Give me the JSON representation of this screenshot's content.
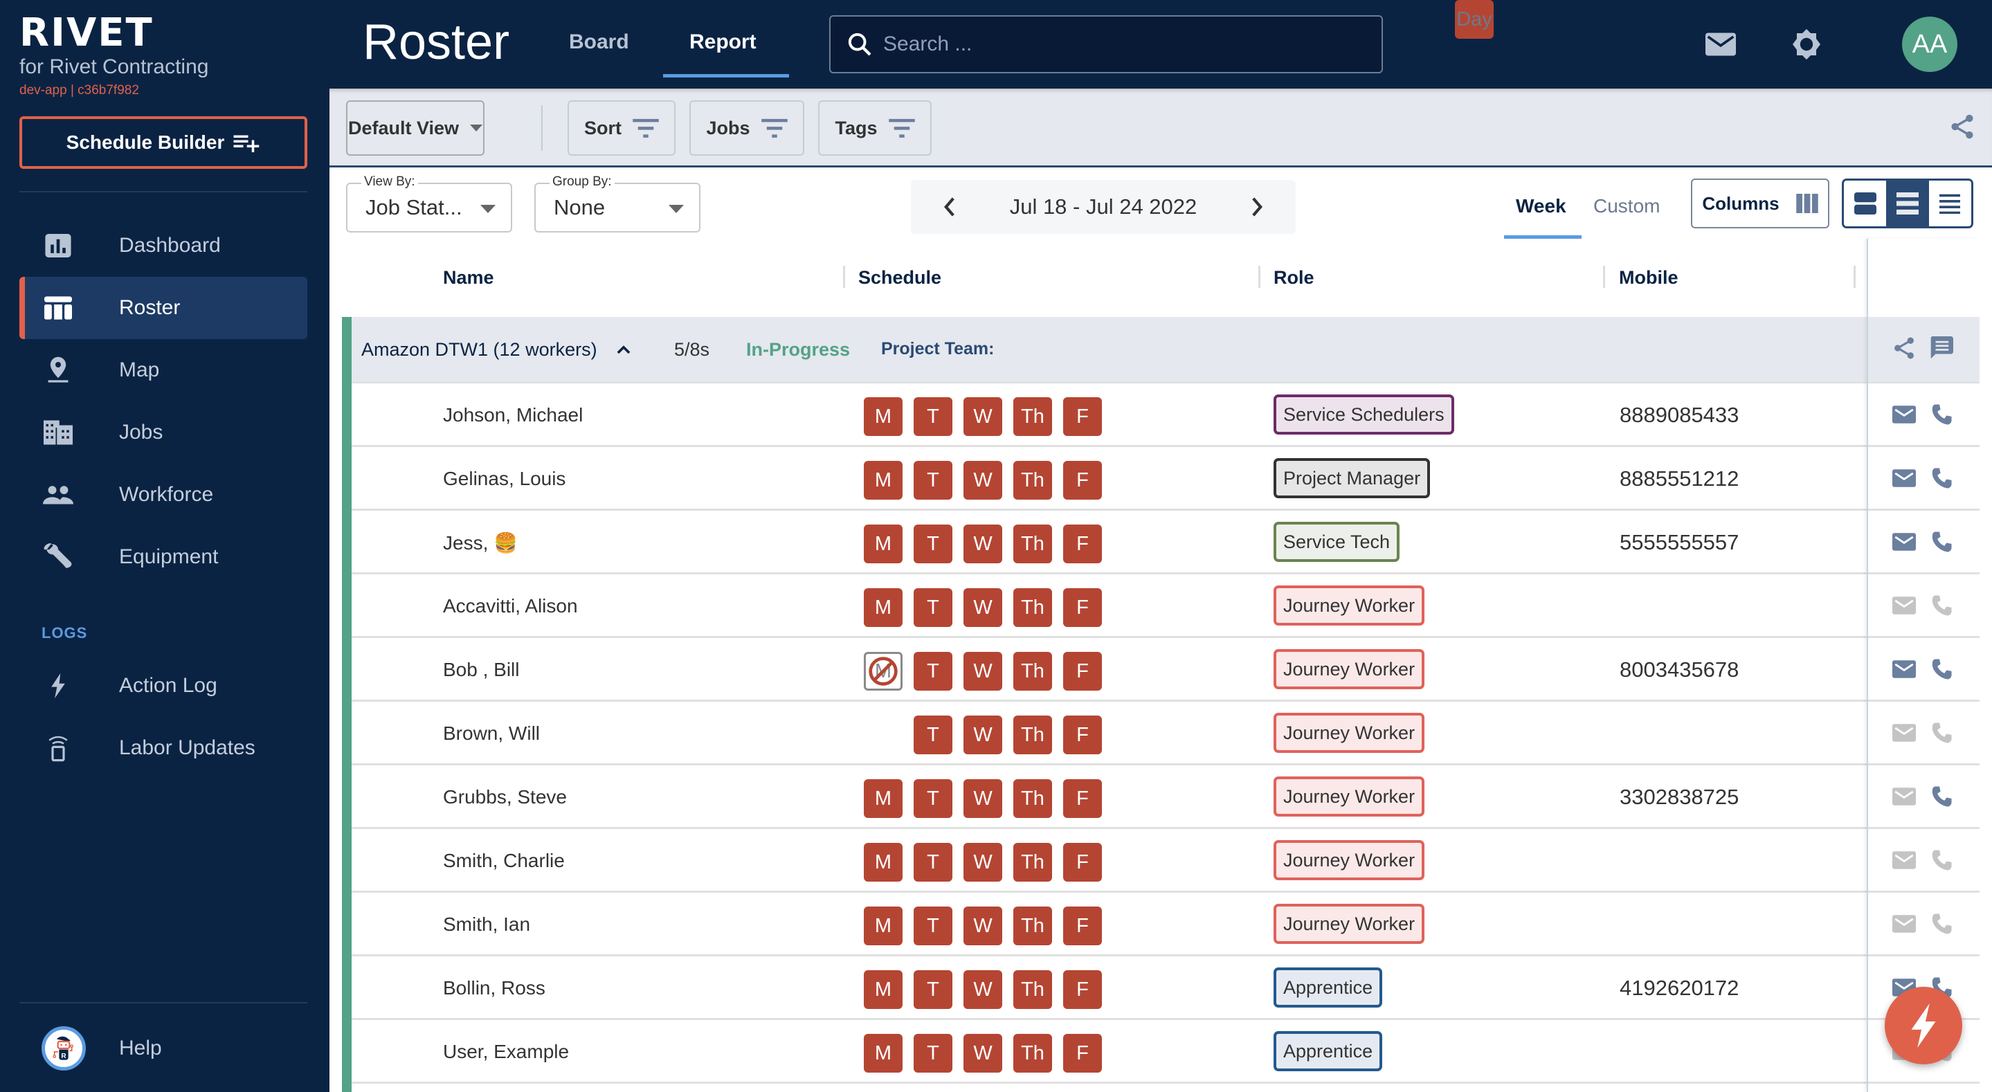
{
  "app": {
    "logo": "RIVET",
    "org": "for Rivet Contracting",
    "build": "dev-app | c36b7f982",
    "schedule_builder_label": "Schedule Builder"
  },
  "sidebar": {
    "items": [
      {
        "label": "Dashboard",
        "icon": "bar-chart-icon",
        "active": false
      },
      {
        "label": "Roster",
        "icon": "table-icon",
        "active": true
      },
      {
        "label": "Map",
        "icon": "map-pin-icon",
        "active": false
      },
      {
        "label": "Jobs",
        "icon": "building-icon",
        "active": false
      },
      {
        "label": "Workforce",
        "icon": "people-icon",
        "active": false
      },
      {
        "label": "Equipment",
        "icon": "wrench-icon",
        "active": false
      }
    ],
    "logs_label": "LOGS",
    "log_items": [
      {
        "label": "Action Log",
        "icon": "bolt-icon"
      },
      {
        "label": "Labor Updates",
        "icon": "broadcast-icon"
      }
    ],
    "help_label": "Help"
  },
  "header": {
    "title": "Roster",
    "tabs": [
      {
        "label": "Board",
        "active": false
      },
      {
        "label": "Report",
        "active": true
      }
    ],
    "search_placeholder": "Search ...",
    "search_value": "",
    "user_initials": "AA"
  },
  "toolbar": {
    "default_view_label": "Default View",
    "sort_label": "Sort",
    "jobs_label": "Jobs",
    "tags_label": "Tags"
  },
  "controls": {
    "view_by": {
      "label": "View By:",
      "value": "Job Stat..."
    },
    "group_by": {
      "label": "Group By:",
      "value": "None"
    },
    "date_range": "Jul 18  -  Jul 24 2022",
    "range_tabs": [
      {
        "label": "Day",
        "active": false
      },
      {
        "label": "Week",
        "active": true
      },
      {
        "label": "Custom",
        "active": false
      }
    ],
    "columns_label": "Columns",
    "density_selected": "standard"
  },
  "table": {
    "columns": [
      "Name",
      "Schedule",
      "Role",
      "Mobile"
    ],
    "group": {
      "name": "Amazon DTW1 (12 workers)",
      "shift": "5/8s",
      "status": "In-Progress",
      "team_label": "Project Team:"
    },
    "role_styles": {
      "Service Schedulers": {
        "border": "#6b2c68",
        "bg": "#ede3ec"
      },
      "Project Manager": {
        "border": "#333333",
        "bg": "#e6e6e6"
      },
      "Service Tech": {
        "border": "#6a8450",
        "bg": "#edf0ea"
      },
      "Journey Worker": {
        "border": "#e0625b",
        "bg": "#fae9e8"
      },
      "Apprentice": {
        "border": "#235a8e",
        "bg": "#e5eaf2"
      }
    },
    "colors": {
      "day_on": "#b44533",
      "status": "#54a287",
      "icon_active": "#6b7f9e",
      "icon_inactive": "#c4c4c4"
    },
    "rows": [
      {
        "name": "Johson, Michael",
        "days": [
          "on",
          "on",
          "on",
          "on",
          "on"
        ],
        "role": "Service Schedulers",
        "mobile": "8889085433",
        "email_active": true,
        "phone_active": true
      },
      {
        "name": "Gelinas, Louis",
        "days": [
          "on",
          "on",
          "on",
          "on",
          "on"
        ],
        "role": "Project Manager",
        "mobile": "8885551212",
        "email_active": true,
        "phone_active": true
      },
      {
        "name": "Jess, 🍔",
        "days": [
          "on",
          "on",
          "on",
          "on",
          "on"
        ],
        "role": "Service Tech",
        "mobile": "5555555557",
        "email_active": true,
        "phone_active": true
      },
      {
        "name": "Accavitti, Alison",
        "days": [
          "on",
          "on",
          "on",
          "on",
          "on"
        ],
        "role": "Journey Worker",
        "mobile": "",
        "email_active": false,
        "phone_active": false
      },
      {
        "name": "Bob , Bill",
        "days": [
          "off",
          "on",
          "on",
          "on",
          "on"
        ],
        "role": "Journey Worker",
        "mobile": "8003435678",
        "email_active": true,
        "phone_active": true
      },
      {
        "name": "Brown, Will",
        "days": [
          "none",
          "on",
          "on",
          "on",
          "on"
        ],
        "role": "Journey Worker",
        "mobile": "",
        "email_active": false,
        "phone_active": false
      },
      {
        "name": "Grubbs, Steve",
        "days": [
          "on",
          "on",
          "on",
          "on",
          "on"
        ],
        "role": "Journey Worker",
        "mobile": "3302838725",
        "email_active": false,
        "phone_active": true
      },
      {
        "name": "Smith, Charlie",
        "days": [
          "on",
          "on",
          "on",
          "on",
          "on"
        ],
        "role": "Journey Worker",
        "mobile": "",
        "email_active": false,
        "phone_active": false
      },
      {
        "name": "Smith, Ian",
        "days": [
          "on",
          "on",
          "on",
          "on",
          "on"
        ],
        "role": "Journey Worker",
        "mobile": "",
        "email_active": false,
        "phone_active": false
      },
      {
        "name": "Bollin, Ross",
        "days": [
          "on",
          "on",
          "on",
          "on",
          "on"
        ],
        "role": "Apprentice",
        "mobile": "4192620172",
        "email_active": true,
        "phone_active": true
      },
      {
        "name": "User, Example",
        "days": [
          "on",
          "on",
          "on",
          "on",
          "on"
        ],
        "role": "Apprentice",
        "mobile": "",
        "email_active": false,
        "phone_active": false
      }
    ],
    "day_labels": [
      "M",
      "T",
      "W",
      "Th",
      "F"
    ]
  }
}
